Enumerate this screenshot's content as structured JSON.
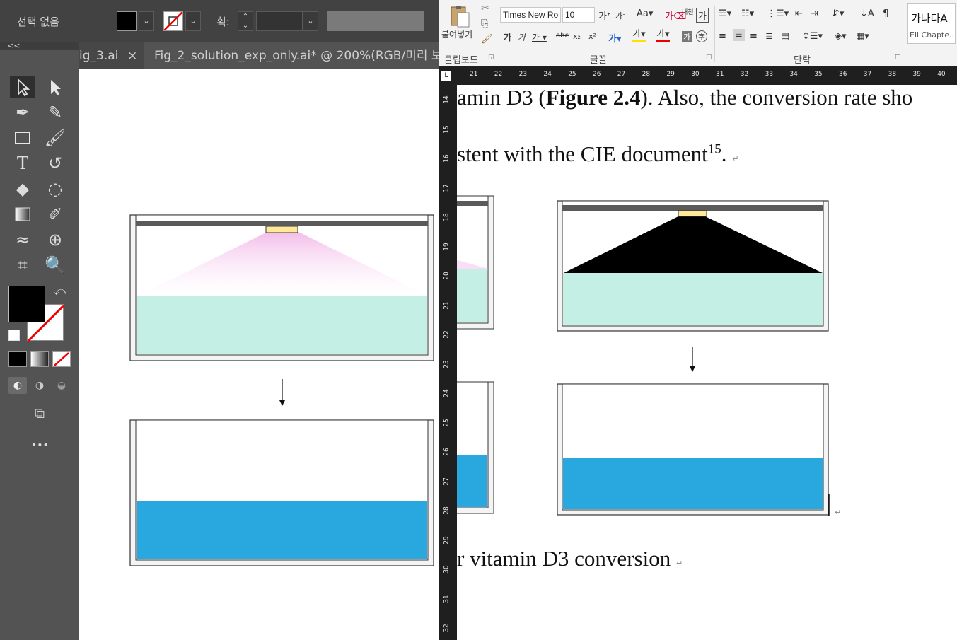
{
  "illustrator": {
    "control_bar": {
      "selection_label": "선택 없음",
      "stroke_label": "획:",
      "fill_color": "#000000"
    },
    "tabs": [
      {
        "label": "ig_3.ai",
        "close": "×"
      },
      {
        "label": "Fig_2_solution_exp_only.ai*  @  200%(RGB/미리 보"
      }
    ],
    "toolbar": {
      "collapse_label": "<<",
      "tools": [
        "selection-tool",
        "direct-selection-tool",
        "pen-tool",
        "curvature-tool",
        "rectangle-tool",
        "paintbrush-tool",
        "type-tool",
        "rotate-tool",
        "eraser-tool",
        "lasso-tool",
        "gradient-tool",
        "eyedropper-tool",
        "warp-tool",
        "shape-builder-tool",
        "artboard-tool",
        "zoom-tool"
      ],
      "more_label": "•••"
    },
    "figure_colors": {
      "water_top": "#c4efe4",
      "water_bottom": "#29a8e0",
      "lamp": "#ffe89a",
      "light_cone": "#f5c6ec",
      "lid": "#5a5a5a"
    }
  },
  "word": {
    "ribbon": {
      "paste_label": "붙여넣기",
      "clipboard_label": "클립보드",
      "font_name": "Times New Ro",
      "font_size": "10",
      "font_group_label": "글꼴",
      "paragraph_group_label": "단락",
      "style_preview": "가나다A",
      "style_name": "Eli Chapte..."
    },
    "h_ruler": [
      "21",
      "22",
      "23",
      "24",
      "25",
      "26",
      "27",
      "28",
      "29",
      "30",
      "31",
      "32",
      "33",
      "34",
      "35",
      "36",
      "37",
      "38",
      "39",
      "40"
    ],
    "v_ruler": [
      "14",
      "15",
      "16",
      "17",
      "18",
      "19",
      "20",
      "21",
      "22",
      "23",
      "24",
      "25",
      "26",
      "27",
      "28",
      "29",
      "30",
      "31",
      "32"
    ],
    "document": {
      "line1_prefix": "amin D3 (",
      "line1_bold": "Figure 2.4",
      "line1_suffix": "). Also, the conversion rate sho",
      "line2": "stent with the CIE document",
      "line2_sup": "15",
      "line2_end": ".",
      "caption": "r vitamin D3 conversion",
      "para_mark": "↵"
    }
  }
}
